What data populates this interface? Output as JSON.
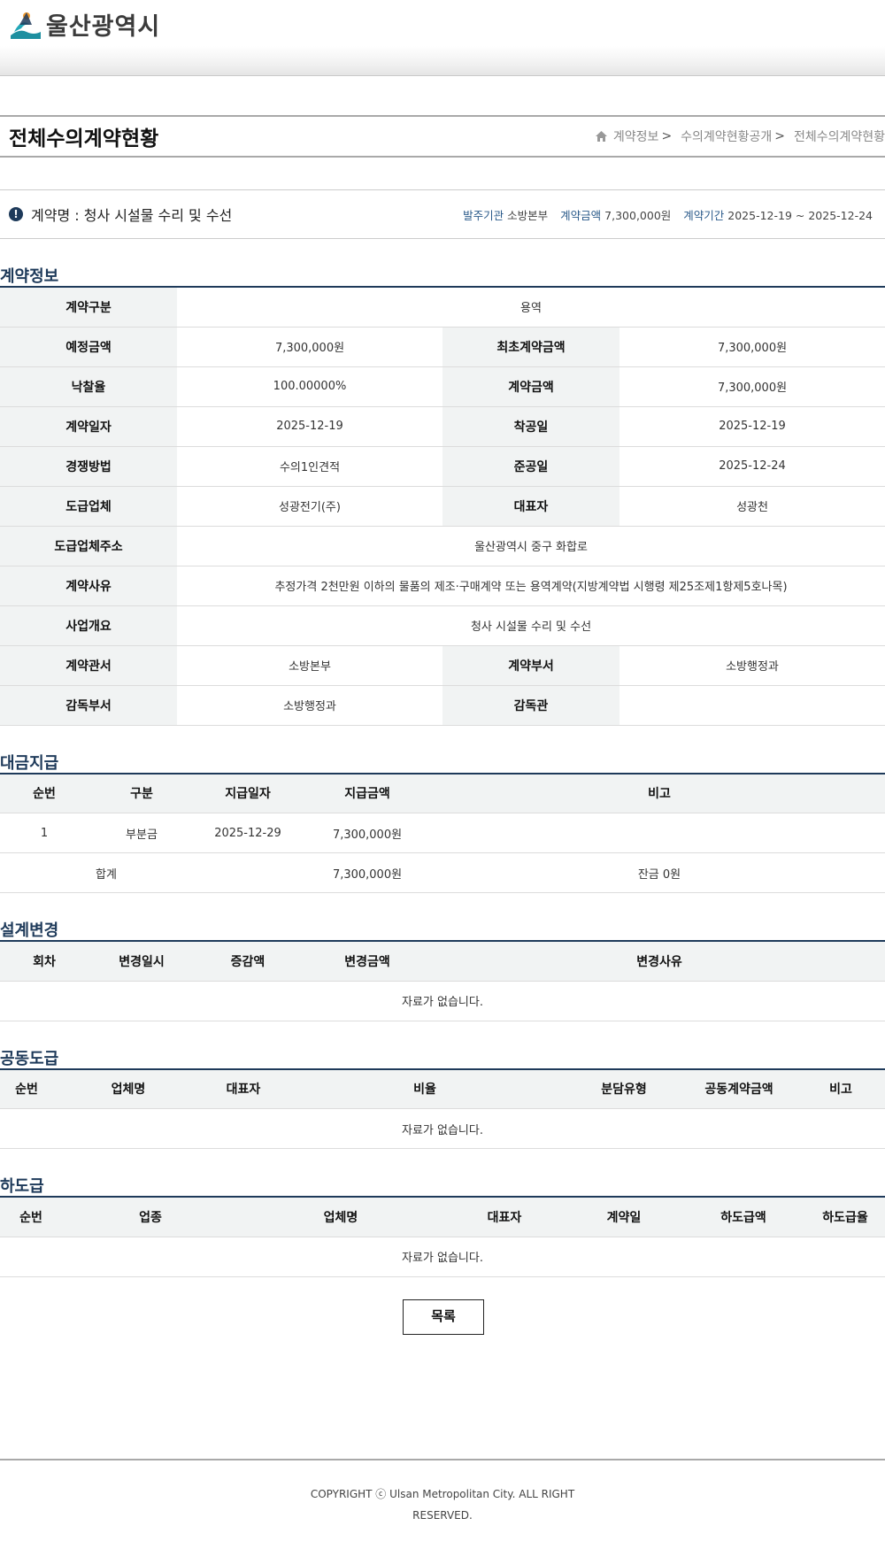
{
  "header": {
    "logo_text": "울산광역시"
  },
  "page": {
    "title": "전체수의계약현황",
    "breadcrumb": [
      "계약정보",
      "수의계약현황공개",
      "전체수의계약현황"
    ],
    "breadcrumb_sep": ">"
  },
  "summary": {
    "contract_name": "계약명 : 청사 시설물 수리 및 수선",
    "ordering_label": "발주기관",
    "ordering_value": "소방본부",
    "amount_label": "계약금액",
    "amount_value": "7,300,000원",
    "period_label": "계약기간",
    "period_value": "2025-12-19 ~ 2025-12-24"
  },
  "contract_info": {
    "section_title": "계약정보",
    "type_label": "계약구분",
    "type_value": "용역",
    "est_label": "예정금액",
    "est_value": "7,300,000원",
    "init_label": "최초계약금액",
    "init_value": "7,300,000원",
    "rate_label": "낙찰율",
    "rate_value": "100.00000%",
    "amount_label": "계약금액",
    "amount_value": "7,300,000원",
    "date_label": "계약일자",
    "date_value": "2025-12-19",
    "start_label": "착공일",
    "start_value": "2025-12-19",
    "method_label": "경쟁방법",
    "method_value": "수의1인견적",
    "end_label": "준공일",
    "end_value": "2025-12-24",
    "vendor_label": "도급업체",
    "vendor_value": "성광전기(주)",
    "rep_label": "대표자",
    "rep_value": "성광천",
    "addr_label": "도급업체주소",
    "addr_value": "울산광역시 중구 화합로",
    "reason_label": "계약사유",
    "reason_value": "추정가격 2천만원 이하의 물품의 제조·구매계약 또는 용역계약(지방계약법 시행령 제25조제1항제5호나목)",
    "overview_label": "사업개요",
    "overview_value": "청사 시설물 수리 및 수선",
    "office_label": "계약관서",
    "office_value": "소방본부",
    "dept_label": "계약부서",
    "dept_value": "소방행정과",
    "sup_dept_label": "감독부서",
    "sup_dept_value": "소방행정과",
    "supervisor_label": "감독관",
    "supervisor_value": ""
  },
  "payment": {
    "section_title": "대금지급",
    "headers": [
      "순번",
      "구분",
      "지급일자",
      "지급금액",
      "비고"
    ],
    "rows": [
      [
        "1",
        "부분금",
        "2025-12-29",
        "7,300,000원",
        ""
      ]
    ],
    "total_label": "합계",
    "total_amount": "7,300,000원",
    "balance": "잔금 0원"
  },
  "design_change": {
    "section_title": "설계변경",
    "headers": [
      "회차",
      "변경일시",
      "증감액",
      "변경금액",
      "변경사유"
    ],
    "empty": "자료가 없습니다."
  },
  "joint": {
    "section_title": "공동도급",
    "headers": [
      "순번",
      "업체명",
      "대표자",
      "비율",
      "분담유형",
      "공동계약금액",
      "비고"
    ],
    "empty": "자료가 없습니다."
  },
  "subcontract": {
    "section_title": "하도급",
    "headers": [
      "순번",
      "업종",
      "업체명",
      "대표자",
      "계약일",
      "하도급액",
      "하도급율"
    ],
    "empty": "자료가 없습니다."
  },
  "list_button": "목록",
  "footer": {
    "line1": "COPYRIGHT ⓒ Ulsan Metropolitan City. ALL RIGHT",
    "line2": "RESERVED."
  }
}
